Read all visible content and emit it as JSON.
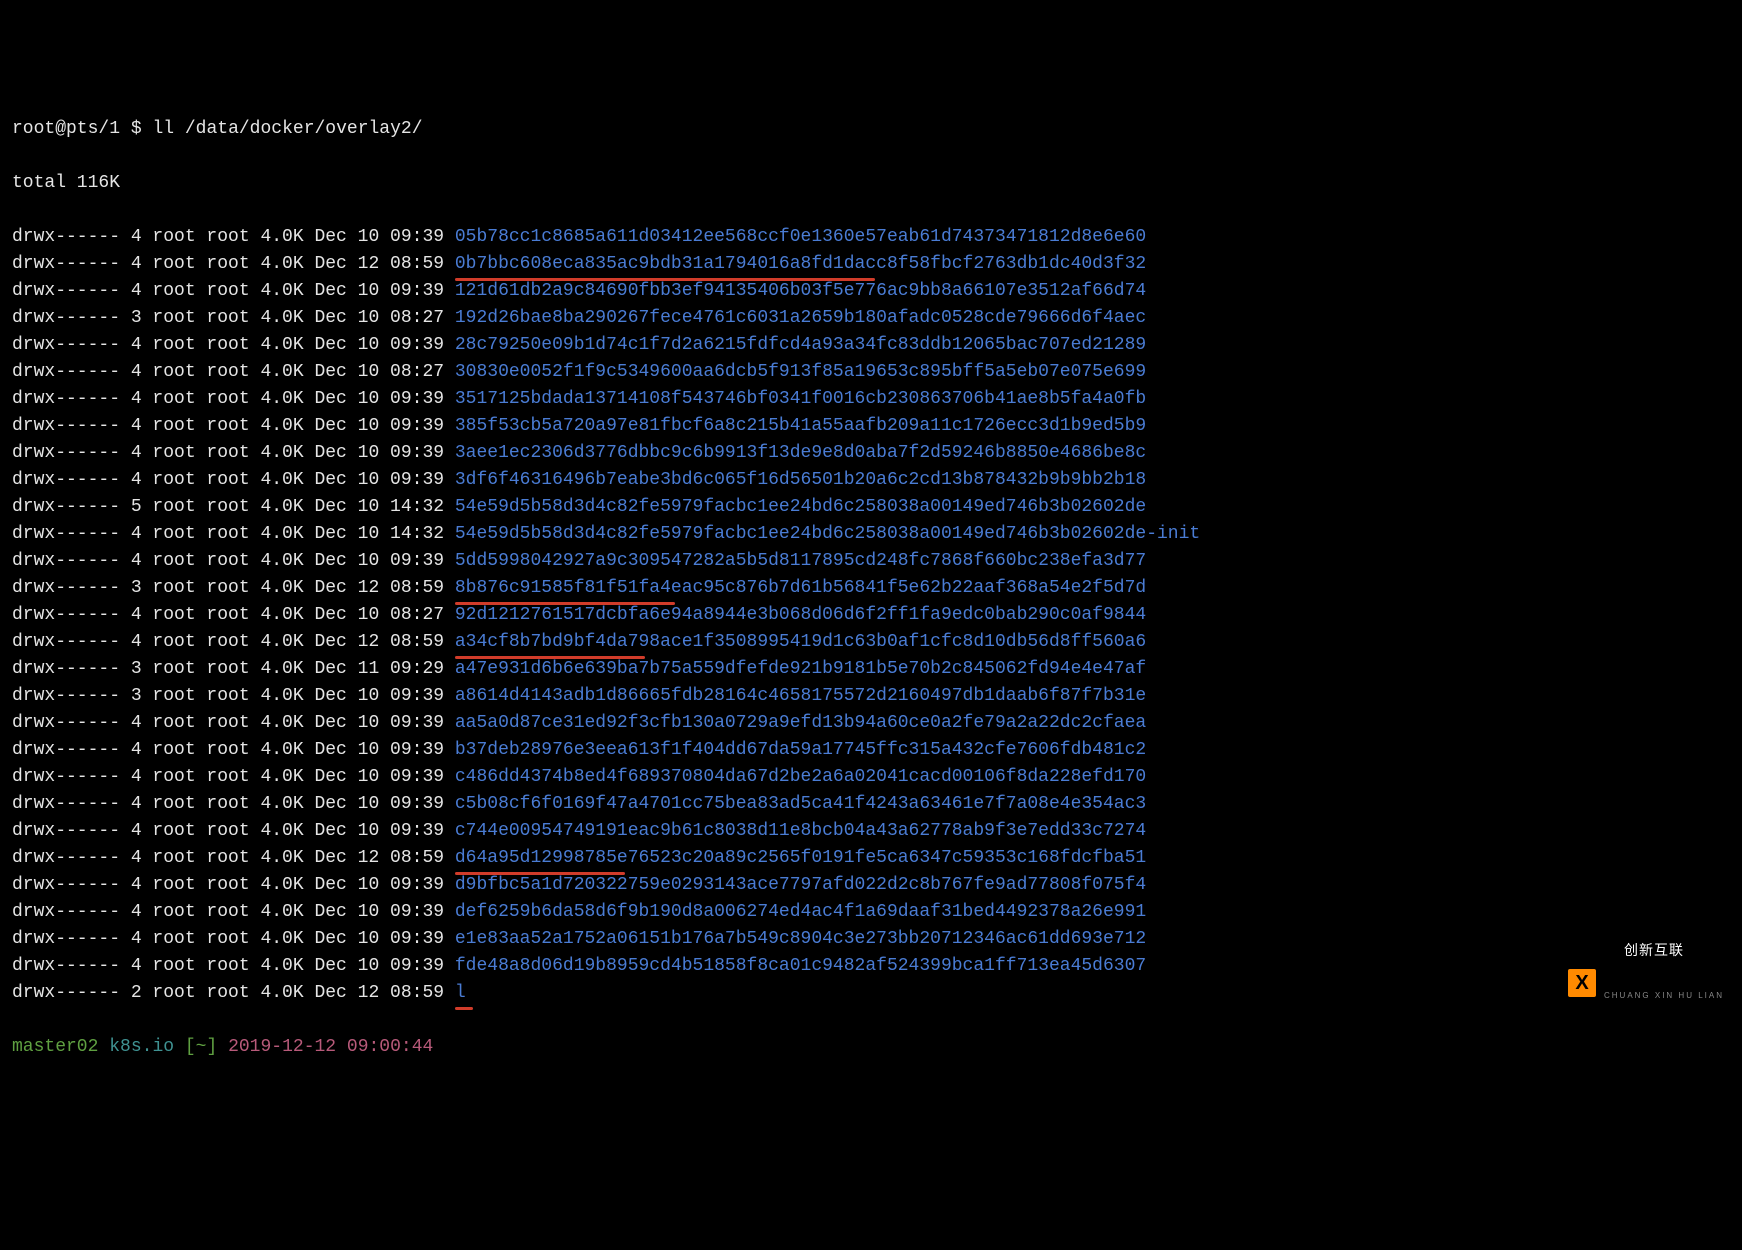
{
  "prompt": {
    "user_host": "root@pts/1",
    "dollar": "$",
    "cmd": "ll /data/docker/overlay2/"
  },
  "total_line": "total 116K",
  "cols": {
    "gap": " "
  },
  "rows": [
    {
      "perm": "drwx------",
      "links": "4",
      "owner": "root",
      "group": "root",
      "size": "4.0K",
      "date": "Dec 10",
      "time": "09:39",
      "name": "05b78cc1c8685a611d03412ee568ccf0e1360e57eab61d74373471812d8e6e60",
      "ul": ""
    },
    {
      "perm": "drwx------",
      "links": "4",
      "owner": "root",
      "group": "root",
      "size": "4.0K",
      "date": "Dec 12",
      "time": "08:59",
      "name": "0b7bbc608eca835ac9bdb31a1794016a8fd1dacc8f58fbcf2763db1dc40d3f32",
      "ul": "ul-w420"
    },
    {
      "perm": "drwx------",
      "links": "4",
      "owner": "root",
      "group": "root",
      "size": "4.0K",
      "date": "Dec 10",
      "time": "09:39",
      "name": "121d61db2a9c84690fbb3ef94135406b03f5e776ac9bb8a66107e3512af66d74",
      "ul": ""
    },
    {
      "perm": "drwx------",
      "links": "3",
      "owner": "root",
      "group": "root",
      "size": "4.0K",
      "date": "Dec 10",
      "time": "08:27",
      "name": "192d26bae8ba290267fece4761c6031a2659b180afadc0528cde79666d6f4aec",
      "ul": ""
    },
    {
      "perm": "drwx------",
      "links": "4",
      "owner": "root",
      "group": "root",
      "size": "4.0K",
      "date": "Dec 10",
      "time": "09:39",
      "name": "28c79250e09b1d74c1f7d2a6215fdfcd4a93a34fc83ddb12065bac707ed21289",
      "ul": ""
    },
    {
      "perm": "drwx------",
      "links": "4",
      "owner": "root",
      "group": "root",
      "size": "4.0K",
      "date": "Dec 10",
      "time": "08:27",
      "name": "30830e0052f1f9c5349600aa6dcb5f913f85a19653c895bff5a5eb07e075e699",
      "ul": ""
    },
    {
      "perm": "drwx------",
      "links": "4",
      "owner": "root",
      "group": "root",
      "size": "4.0K",
      "date": "Dec 10",
      "time": "09:39",
      "name": "3517125bdada13714108f543746bf0341f0016cb230863706b41ae8b5fa4a0fb",
      "ul": ""
    },
    {
      "perm": "drwx------",
      "links": "4",
      "owner": "root",
      "group": "root",
      "size": "4.0K",
      "date": "Dec 10",
      "time": "09:39",
      "name": "385f53cb5a720a97e81fbcf6a8c215b41a55aafb209a11c1726ecc3d1b9ed5b9",
      "ul": ""
    },
    {
      "perm": "drwx------",
      "links": "4",
      "owner": "root",
      "group": "root",
      "size": "4.0K",
      "date": "Dec 10",
      "time": "09:39",
      "name": "3aee1ec2306d3776dbbc9c6b9913f13de9e8d0aba7f2d59246b8850e4686be8c",
      "ul": ""
    },
    {
      "perm": "drwx------",
      "links": "4",
      "owner": "root",
      "group": "root",
      "size": "4.0K",
      "date": "Dec 10",
      "time": "09:39",
      "name": "3df6f46316496b7eabe3bd6c065f16d56501b20a6c2cd13b878432b9b9bb2b18",
      "ul": ""
    },
    {
      "perm": "drwx------",
      "links": "5",
      "owner": "root",
      "group": "root",
      "size": "4.0K",
      "date": "Dec 10",
      "time": "14:32",
      "name": "54e59d5b58d3d4c82fe5979facbc1ee24bd6c258038a00149ed746b3b02602de",
      "ul": ""
    },
    {
      "perm": "drwx------",
      "links": "4",
      "owner": "root",
      "group": "root",
      "size": "4.0K",
      "date": "Dec 10",
      "time": "14:32",
      "name": "54e59d5b58d3d4c82fe5979facbc1ee24bd6c258038a00149ed746b3b02602de-init",
      "ul": ""
    },
    {
      "perm": "drwx------",
      "links": "4",
      "owner": "root",
      "group": "root",
      "size": "4.0K",
      "date": "Dec 10",
      "time": "09:39",
      "name": "5dd5998042927a9c309547282a5b5d8117895cd248fc7868f660bc238efa3d77",
      "ul": ""
    },
    {
      "perm": "drwx------",
      "links": "3",
      "owner": "root",
      "group": "root",
      "size": "4.0K",
      "date": "Dec 12",
      "time": "08:59",
      "name": "8b876c91585f81f51fa4eac95c876b7d61b56841f5e62b22aaf368a54e2f5d7d",
      "ul": "ul-w220"
    },
    {
      "perm": "drwx------",
      "links": "4",
      "owner": "root",
      "group": "root",
      "size": "4.0K",
      "date": "Dec 10",
      "time": "08:27",
      "name": "92d1212761517dcbfa6e94a8944e3b068d06d6f2ff1fa9edc0bab290c0af9844",
      "ul": ""
    },
    {
      "perm": "drwx------",
      "links": "4",
      "owner": "root",
      "group": "root",
      "size": "4.0K",
      "date": "Dec 12",
      "time": "08:59",
      "name": "a34cf8b7bd9bf4da798ace1f3508995419d1c63b0af1cfc8d10db56d8ff560a6",
      "ul": "ul-w190"
    },
    {
      "perm": "drwx------",
      "links": "3",
      "owner": "root",
      "group": "root",
      "size": "4.0K",
      "date": "Dec 11",
      "time": "09:29",
      "name": "a47e931d6b6e639ba7b75a559dfefde921b9181b5e70b2c845062fd94e4e47af",
      "ul": ""
    },
    {
      "perm": "drwx------",
      "links": "3",
      "owner": "root",
      "group": "root",
      "size": "4.0K",
      "date": "Dec 10",
      "time": "09:39",
      "name": "a8614d4143adb1d86665fdb28164c4658175572d2160497db1daab6f87f7b31e",
      "ul": ""
    },
    {
      "perm": "drwx------",
      "links": "4",
      "owner": "root",
      "group": "root",
      "size": "4.0K",
      "date": "Dec 10",
      "time": "09:39",
      "name": "aa5a0d87ce31ed92f3cfb130a0729a9efd13b94a60ce0a2fe79a2a22dc2cfaea",
      "ul": ""
    },
    {
      "perm": "drwx------",
      "links": "4",
      "owner": "root",
      "group": "root",
      "size": "4.0K",
      "date": "Dec 10",
      "time": "09:39",
      "name": "b37deb28976e3eea613f1f404dd67da59a17745ffc315a432cfe7606fdb481c2",
      "ul": ""
    },
    {
      "perm": "drwx------",
      "links": "4",
      "owner": "root",
      "group": "root",
      "size": "4.0K",
      "date": "Dec 10",
      "time": "09:39",
      "name": "c486dd4374b8ed4f689370804da67d2be2a6a02041cacd00106f8da228efd170",
      "ul": ""
    },
    {
      "perm": "drwx------",
      "links": "4",
      "owner": "root",
      "group": "root",
      "size": "4.0K",
      "date": "Dec 10",
      "time": "09:39",
      "name": "c5b08cf6f0169f47a4701cc75bea83ad5ca41f4243a63461e7f7a08e4e354ac3",
      "ul": ""
    },
    {
      "perm": "drwx------",
      "links": "4",
      "owner": "root",
      "group": "root",
      "size": "4.0K",
      "date": "Dec 10",
      "time": "09:39",
      "name": "c744e00954749191eac9b61c8038d11e8bcb04a43a62778ab9f3e7edd33c7274",
      "ul": ""
    },
    {
      "perm": "drwx------",
      "links": "4",
      "owner": "root",
      "group": "root",
      "size": "4.0K",
      "date": "Dec 12",
      "time": "08:59",
      "name": "d64a95d12998785e76523c20a89c2565f0191fe5ca6347c59353c168fdcfba51",
      "ul": "ul-w170"
    },
    {
      "perm": "drwx------",
      "links": "4",
      "owner": "root",
      "group": "root",
      "size": "4.0K",
      "date": "Dec 10",
      "time": "09:39",
      "name": "d9bfbc5a1d720322759e0293143ace7797afd022d2c8b767fe9ad77808f075f4",
      "ul": ""
    },
    {
      "perm": "drwx------",
      "links": "4",
      "owner": "root",
      "group": "root",
      "size": "4.0K",
      "date": "Dec 10",
      "time": "09:39",
      "name": "def6259b6da58d6f9b190d8a006274ed4ac4f1a69daaf31bed4492378a26e991",
      "ul": ""
    },
    {
      "perm": "drwx------",
      "links": "4",
      "owner": "root",
      "group": "root",
      "size": "4.0K",
      "date": "Dec 10",
      "time": "09:39",
      "name": "e1e83aa52a1752a06151b176a7b549c8904c3e273bb20712346ac61dd693e712",
      "ul": ""
    },
    {
      "perm": "drwx------",
      "links": "4",
      "owner": "root",
      "group": "root",
      "size": "4.0K",
      "date": "Dec 10",
      "time": "09:39",
      "name": "fde48a8d06d19b8959cd4b51858f8ca01c9482af524399bca1ff713ea45d6307",
      "ul": ""
    },
    {
      "perm": "drwx------",
      "links": "2",
      "owner": "root",
      "group": "root",
      "size": "4.0K",
      "date": "Dec 12",
      "time": "08:59",
      "name": "l",
      "ul": "ul-w18"
    }
  ],
  "bottom_prompt": {
    "host": "master02",
    "path": "k8s.io",
    "tilde": "[~]",
    "datetime": "2019-12-12 09:00:44"
  },
  "watermark": {
    "icon_letter": "X",
    "text": "创新互联",
    "sub": "CHUANG XIN HU LIAN"
  }
}
